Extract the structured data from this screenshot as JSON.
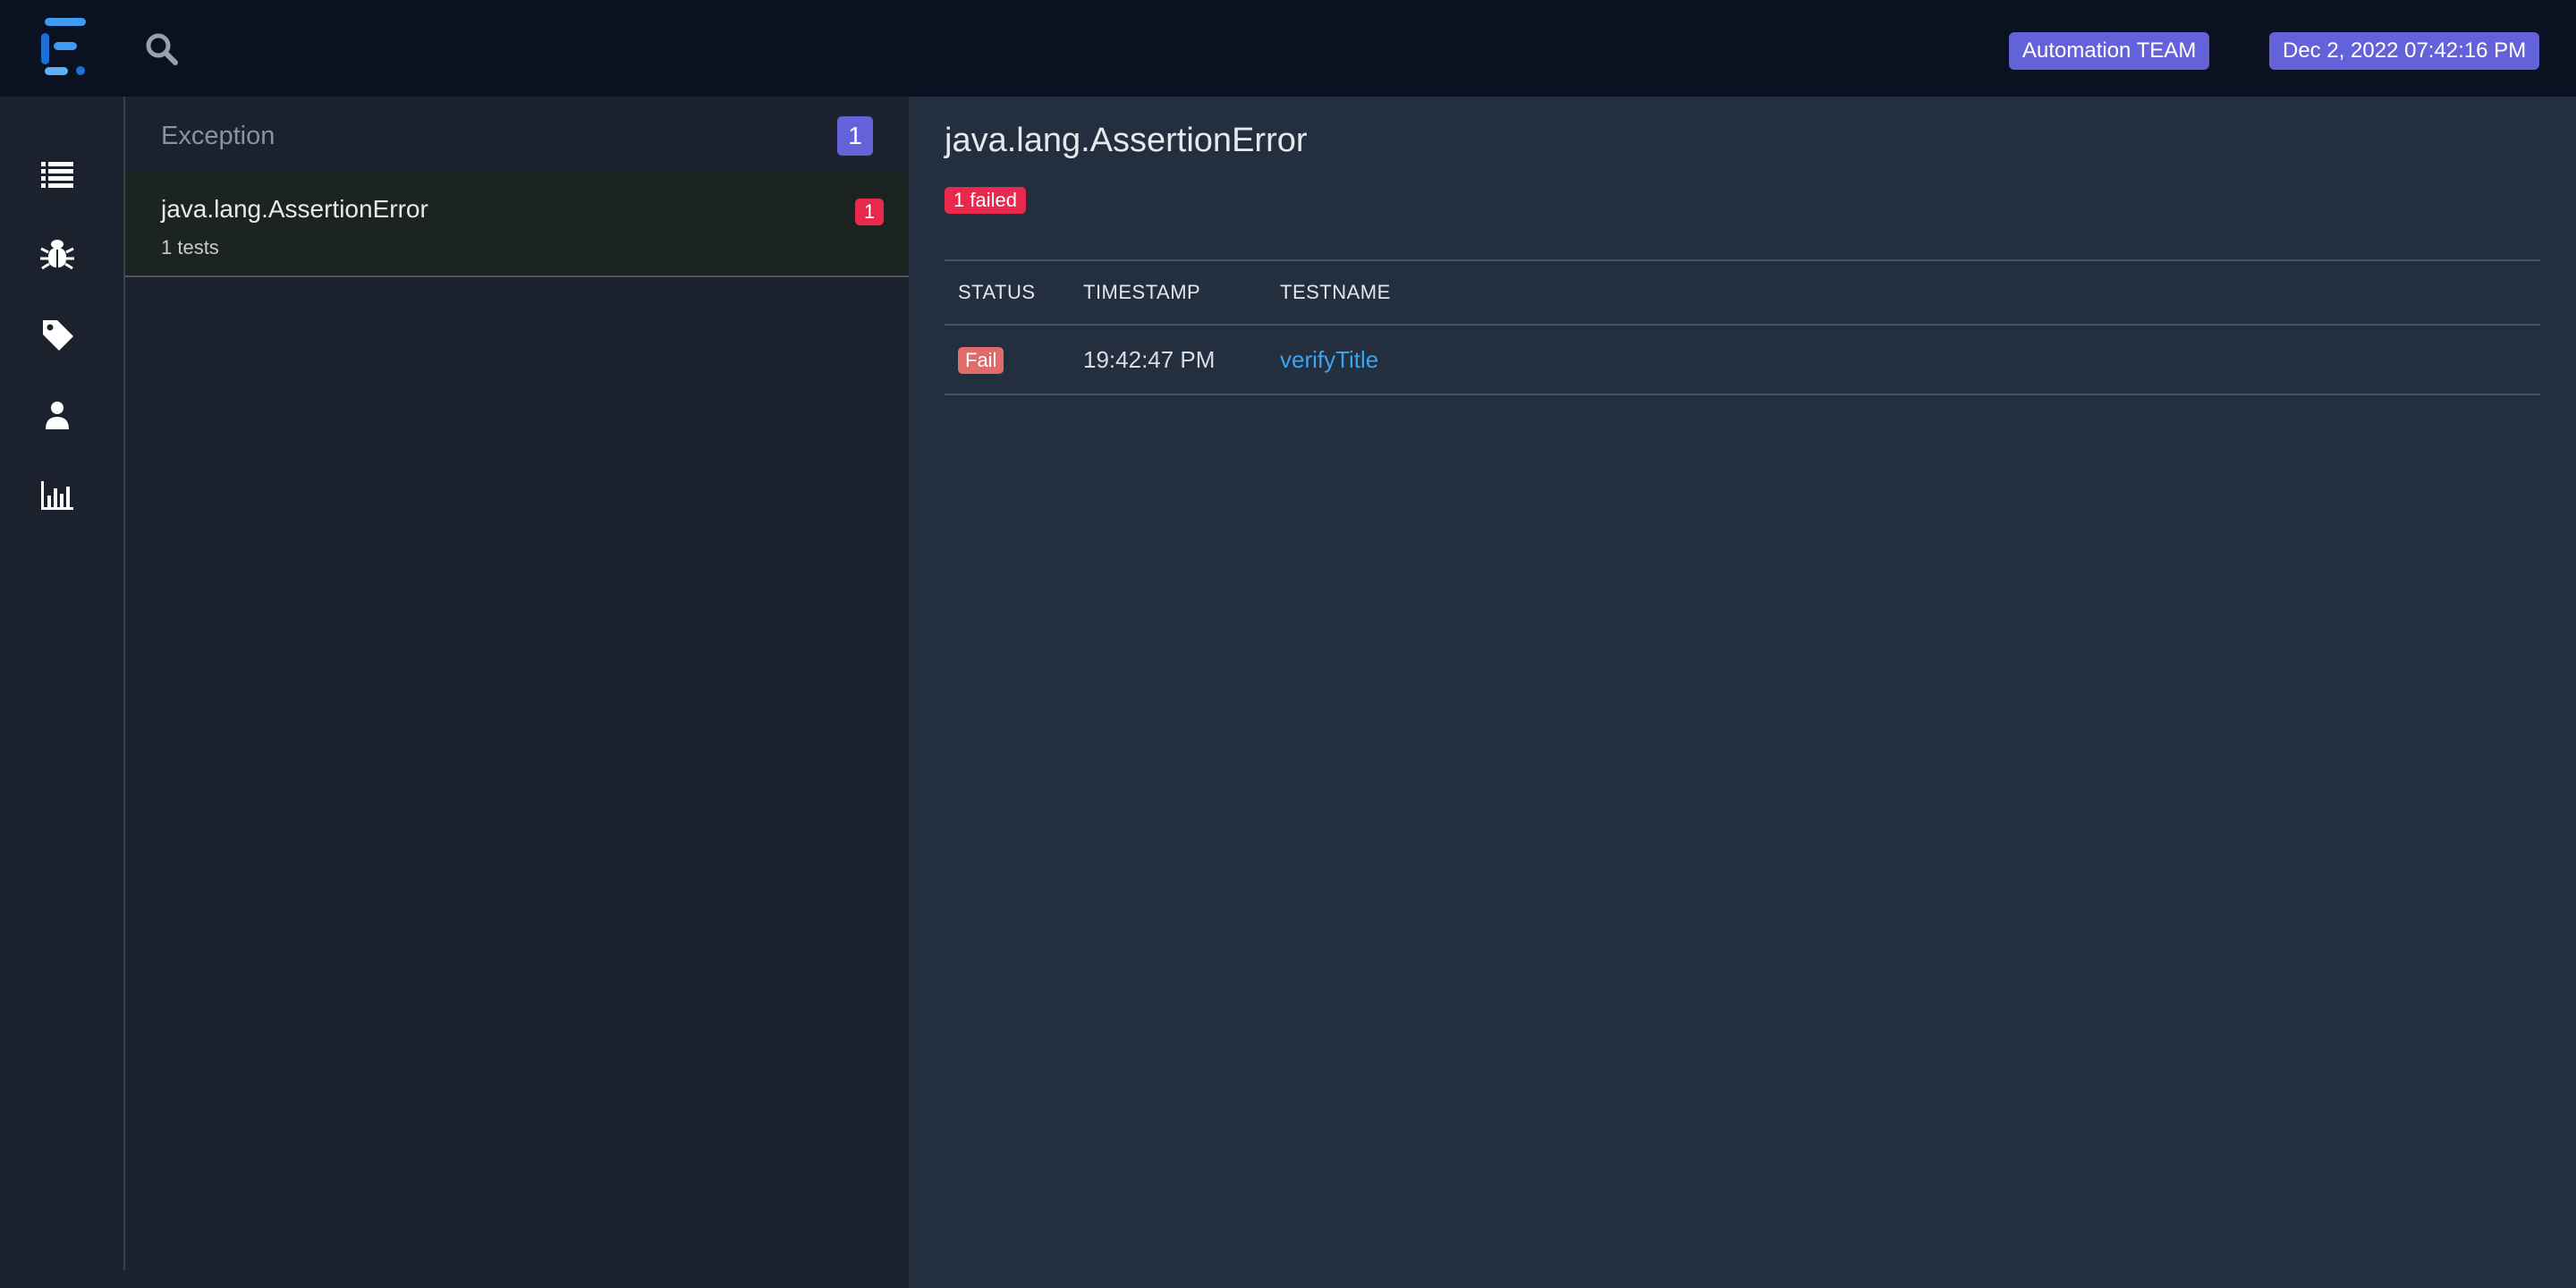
{
  "header": {
    "logo_icon": "extent-logo-icon",
    "search_icon": "search-icon",
    "team_label": "Automation TEAM",
    "datetime": "Dec 2, 2022 07:42:16 PM",
    "accent_color": "#6462d8"
  },
  "sidebar": {
    "items": [
      {
        "icon": "list-icon",
        "active": false
      },
      {
        "icon": "bug-icon",
        "active": true
      },
      {
        "icon": "tag-icon",
        "active": false
      },
      {
        "icon": "user-icon",
        "active": false
      },
      {
        "icon": "bar-chart-icon",
        "active": false
      }
    ]
  },
  "list": {
    "header_title": "Exception",
    "header_count": "1",
    "items": [
      {
        "name": "java.lang.AssertionError",
        "subtitle": "1 tests",
        "count": "1"
      }
    ]
  },
  "detail": {
    "title": "java.lang.AssertionError",
    "failed_badge": "1 failed",
    "columns": [
      "STATUS",
      "TIMESTAMP",
      "TESTNAME"
    ],
    "rows": [
      {
        "status": "Fail",
        "timestamp": "19:42:47 PM",
        "testname": "verifyTitle"
      }
    ],
    "fail_color": "#e8284d",
    "link_color": "#3aa4f3"
  }
}
